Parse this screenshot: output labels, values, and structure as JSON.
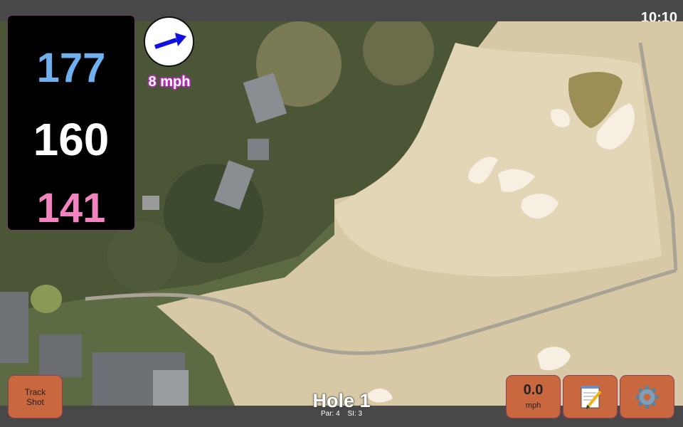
{
  "status": {
    "time": "10:10"
  },
  "distances": {
    "back": "177",
    "middle": "160",
    "front": "141",
    "colors": {
      "back": "#6fb1ee",
      "middle": "#ffffff",
      "front": "#f184bf"
    }
  },
  "wind": {
    "speed_text": "8 mph",
    "direction_icon": "arrow-right-icon"
  },
  "hole": {
    "title": "Hole 1",
    "par": "Par: 4",
    "si": "SI: 3"
  },
  "buttons": {
    "track_shot_line1": "Track",
    "track_shot_line2": "Shot",
    "speed_value": "0.0",
    "speed_unit": "mph",
    "notes_icon": "notepad-icon",
    "settings_icon": "gear-icon",
    "accent_color": "#c9683e"
  },
  "map": {
    "type": "satellite"
  }
}
